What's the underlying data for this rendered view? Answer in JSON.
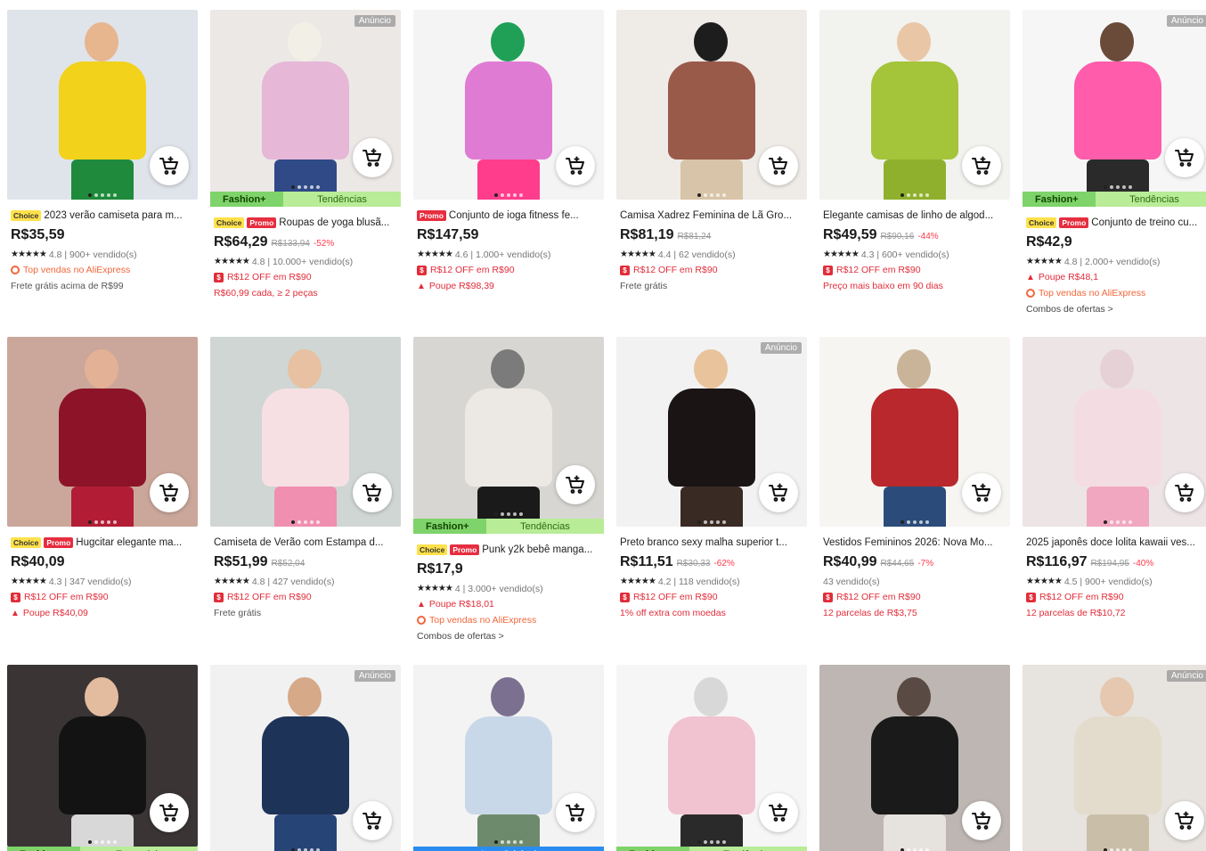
{
  "colors": {
    "price": "#191919",
    "discount": "#ff3a4a",
    "coupon_red": "#e22d3a",
    "top_sales_orange": "#f1663a",
    "fashion_plus_green": "#7ed36a",
    "trend_green": "#b8ec97",
    "original_blue": "#2a8cf0",
    "choice_yellow": "#ffe14a"
  },
  "labels": {
    "ad": "Anúncio",
    "fashion_plus": "Fashion+",
    "trends": "Tendências",
    "essentials": "Essenciais",
    "original_item": "Item Original",
    "choice": "Choice",
    "promo": "Promo"
  },
  "icons": {
    "cart": "add-to-cart-icon",
    "coupon": "coupon-icon",
    "flame": "flame-icon",
    "top_sales": "ring-icon"
  },
  "products": [
    {
      "title": "2023 verão camiseta para m...",
      "badges": [
        "Choice"
      ],
      "price": "R$35,59",
      "rating": "4.8 | 900+ vendido(s)",
      "lines": [
        {
          "kind": "top",
          "text": "Top vendas no AliExpress"
        },
        {
          "kind": "gray",
          "text": "Frete grátis acima de R$99"
        }
      ],
      "strip": null,
      "ad": false
    },
    {
      "title": "Roupas de yoga blusã...",
      "badges": [
        "Choice",
        "Promo"
      ],
      "price": "R$64,29",
      "old_price": "R$133,94",
      "discount": "-52%",
      "rating": "4.8 | 10.000+ vendido(s)",
      "lines": [
        {
          "kind": "coupon",
          "text": "R$12 OFF em R$90"
        },
        {
          "kind": "red",
          "text": "R$60,99 cada, ≥ 2 peças"
        }
      ],
      "strip": "fashion-trends",
      "ad": true
    },
    {
      "title": "Conjunto de ioga fitness fe...",
      "badges": [
        "Promo"
      ],
      "price": "R$147,59",
      "rating": "4.6 | 1.000+ vendido(s)",
      "lines": [
        {
          "kind": "coupon",
          "text": "R$12 OFF em R$90"
        },
        {
          "kind": "flame",
          "text": "Poupe R$98,39"
        }
      ],
      "strip": null,
      "ad": false
    },
    {
      "title": "Camisa Xadrez Feminina de Lã Gro...",
      "badges": [],
      "price": "R$81,19",
      "old_price": "R$81,24",
      "rating": "4.4 | 62 vendido(s)",
      "lines": [
        {
          "kind": "coupon",
          "text": "R$12 OFF em R$90"
        },
        {
          "kind": "gray",
          "text": "Frete grátis"
        }
      ],
      "strip": null,
      "ad": false
    },
    {
      "title": "Elegante camisas de linho de algod...",
      "badges": [],
      "price": "R$49,59",
      "old_price": "R$90,16",
      "discount": "-44%",
      "rating": "4.3 | 600+ vendido(s)",
      "lines": [
        {
          "kind": "coupon",
          "text": "R$12 OFF em R$90"
        },
        {
          "kind": "red",
          "text": "Preço mais baixo em 90 dias"
        }
      ],
      "strip": null,
      "ad": false
    },
    {
      "title": "Conjunto de treino cu...",
      "badges": [
        "Choice",
        "Promo"
      ],
      "price": "R$42,9",
      "rating": "4.8 | 2.000+ vendido(s)",
      "lines": [
        {
          "kind": "flame",
          "text": "Poupe R$48,1"
        },
        {
          "kind": "top",
          "text": "Top vendas no AliExpress"
        },
        {
          "kind": "dark",
          "text": "Combos de ofertas >"
        }
      ],
      "strip": "fashion-trends",
      "ad": true
    },
    {
      "title": "Hugcitar elegante ma...",
      "badges": [
        "Choice",
        "Promo"
      ],
      "price": "R$40,09",
      "rating": "4.3 | 347 vendido(s)",
      "lines": [
        {
          "kind": "coupon",
          "text": "R$12 OFF em R$90"
        },
        {
          "kind": "flame",
          "text": "Poupe R$40,09"
        }
      ],
      "strip": null,
      "ad": false
    },
    {
      "title": "Camiseta de Verão com Estampa d...",
      "badges": [],
      "price": "R$51,99",
      "old_price": "R$52,04",
      "rating": "4.8 | 427 vendido(s)",
      "lines": [
        {
          "kind": "coupon",
          "text": "R$12 OFF em R$90"
        },
        {
          "kind": "gray",
          "text": "Frete grátis"
        }
      ],
      "strip": null,
      "ad": false
    },
    {
      "title": "Punk y2k bebê manga...",
      "badges": [
        "Choice",
        "Promo"
      ],
      "price": "R$17,9",
      "rating": "4 | 3.000+ vendido(s)",
      "lines": [
        {
          "kind": "flame",
          "text": "Poupe R$18,01"
        },
        {
          "kind": "top",
          "text": "Top vendas no AliExpress"
        },
        {
          "kind": "dark",
          "text": "Combos de ofertas >"
        }
      ],
      "strip": "fashion-trends",
      "ad": false
    },
    {
      "title": "Preto branco sexy malha superior t...",
      "badges": [],
      "price": "R$11,51",
      "old_price": "R$30,33",
      "discount": "-62%",
      "rating": "4.2 | 118 vendido(s)",
      "lines": [
        {
          "kind": "coupon",
          "text": "R$12 OFF em R$90"
        },
        {
          "kind": "red",
          "text": "1% off extra com moedas"
        }
      ],
      "strip": null,
      "ad": true
    },
    {
      "title": "Vestidos Femininos 2026: Nova Mo...",
      "badges": [],
      "price": "R$40,99",
      "old_price": "R$44,65",
      "discount": "-7%",
      "rating": "43 vendido(s)",
      "no_stars": true,
      "lines": [
        {
          "kind": "coupon",
          "text": "R$12 OFF em R$90"
        },
        {
          "kind": "red",
          "text": "12 parcelas de R$3,75"
        }
      ],
      "strip": null,
      "ad": false
    },
    {
      "title": "2025 japonês doce lolita kawaii ves...",
      "badges": [],
      "price": "R$116,97",
      "old_price": "R$194,95",
      "discount": "-40%",
      "rating": "4.5 | 900+ vendido(s)",
      "lines": [
        {
          "kind": "coupon",
          "text": "R$12 OFF em R$90"
        },
        {
          "kind": "red",
          "text": "12 parcelas de R$10,72"
        }
      ],
      "strip": null,
      "ad": false
    },
    {
      "strip": "fashion-essentials",
      "ad": false
    },
    {
      "strip": null,
      "ad": true
    },
    {
      "strip": "original",
      "ad": false
    },
    {
      "strip": "fashion-trends",
      "ad": false
    },
    {
      "strip": null,
      "ad": false
    },
    {
      "strip": null,
      "ad": true
    }
  ]
}
